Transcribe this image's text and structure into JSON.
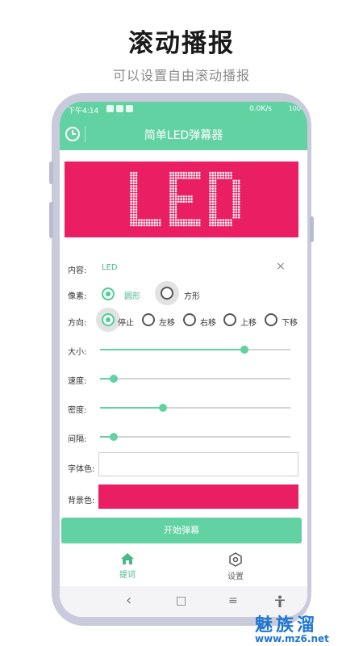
{
  "hero": {
    "title": "滚动播报",
    "subtitle": "可以设置自由滚动播报"
  },
  "statusbar": {
    "time": "下午4:14",
    "network": "0.0K/s",
    "battery": "100"
  },
  "appbar": {
    "title": "简单LED弹幕器",
    "history_icon": "clock-icon"
  },
  "preview": {
    "text": "LED",
    "background": "#e91e63",
    "text_color": "#ffffff"
  },
  "form": {
    "content_label": "内容:",
    "content_value": "LED",
    "clear_icon": "×",
    "pixel_label": "像素:",
    "pixel_options": [
      "圆形",
      "方形"
    ],
    "pixel_selected": "圆形",
    "direction_label": "方向:",
    "direction_options": [
      "停止",
      "左移",
      "右移",
      "上移",
      "下移"
    ],
    "direction_selected": "停止",
    "size_label": "大小:",
    "size_value": 0.76,
    "speed_label": "速度:",
    "speed_value": 0.07,
    "density_label": "密度:",
    "density_value": 0.33,
    "spacing_label": "间隔:",
    "spacing_value": 0.07,
    "font_color_label": "字体色:",
    "font_color": "#ffffff",
    "bg_color_label": "背景色:",
    "bg_color": "#e91e63"
  },
  "start_button": "开始弹幕",
  "tabs": [
    {
      "label": "提词",
      "icon": "home-icon",
      "active": true
    },
    {
      "label": "设置",
      "icon": "settings-hexagon-icon",
      "active": false
    }
  ],
  "navbar": {
    "back": "‹",
    "home": "□",
    "menu": "≡",
    "accessibility": "accessibility-icon"
  },
  "watermark": {
    "text": "魅族溜",
    "url": "www.mz6.net"
  },
  "colors": {
    "accent": "#62d2a2",
    "led_bg": "#e91e63"
  }
}
